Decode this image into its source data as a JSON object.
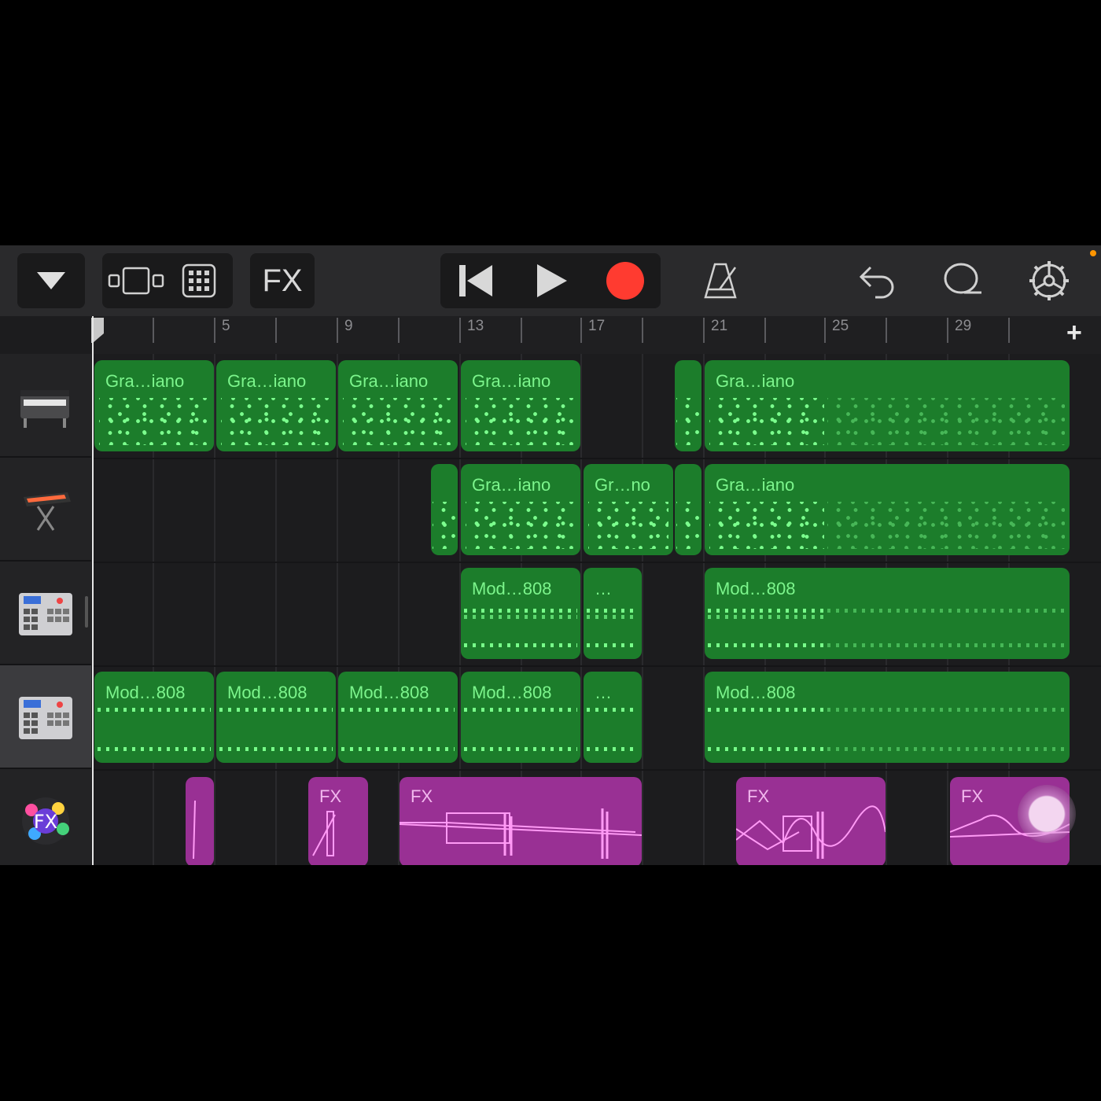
{
  "toolbar": {
    "fx_label": "FX",
    "icons": [
      "chevron-down-icon",
      "tracks-view-icon",
      "grid-view-icon",
      "rewind-icon",
      "play-icon",
      "record-icon",
      "metronome-icon",
      "undo-icon",
      "loop-icon",
      "settings-icon"
    ],
    "record_color": "#ff3b30"
  },
  "ruler": {
    "labels": [
      "5",
      "9",
      "13",
      "17",
      "21",
      "25",
      "29"
    ],
    "add_label": "+"
  },
  "tracks": [
    {
      "instrument": "grand-piano-icon",
      "regions": [
        "Gra…iano",
        "Gra…iano",
        "Gra…iano",
        "Gra…iano",
        "Gra…iano"
      ]
    },
    {
      "instrument": "keyboard-stand-icon",
      "regions": [
        "Gra…iano",
        "Gr…no",
        "Gra…iano"
      ]
    },
    {
      "instrument": "drum-machine-icon",
      "regions": [
        "Mod…808",
        "…",
        "Mod…808"
      ]
    },
    {
      "instrument": "drum-machine-icon",
      "selected": true,
      "regions": [
        "Mod…808",
        "Mod…808",
        "Mod…808",
        "Mod…808",
        "…",
        "Mod…808"
      ]
    },
    {
      "instrument": "fx-icon",
      "regions": [
        "FX",
        "FX",
        "FX",
        "FX"
      ]
    }
  ],
  "colors": {
    "green_region": "#1c7d2b",
    "purple_region": "#993094",
    "note": "#7cff8e"
  }
}
